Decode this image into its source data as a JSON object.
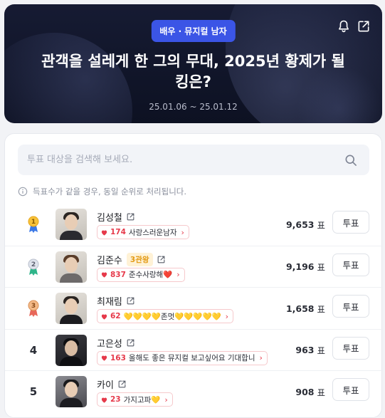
{
  "header": {
    "category": "배우 · 뮤지컬 남자",
    "title": "관객을 설레게 한 그의 무대, 2025년 황제가 될 킹은?",
    "dates": "25.01.06 ~ 25.01.12",
    "icons": [
      "bell-icon",
      "share-icon"
    ]
  },
  "search": {
    "placeholder": "투표 대상을 검색해 보세요."
  },
  "notice": "득표수가 같을 경우, 동일 순위로 처리됩니다.",
  "vote_unit": "표",
  "vote_label": "투표",
  "colors": {
    "accent": "#3b55e6",
    "cheer_red": "#e6394a",
    "gold": "#e39a14",
    "header_bg": "#161b33"
  },
  "ranking": [
    {
      "rank": "1",
      "medal": "gold",
      "name": "김성철",
      "winner_tag": "",
      "cheer_count": "174",
      "cheer_msg": "사랑스러운남자",
      "votes": "9,653"
    },
    {
      "rank": "2",
      "medal": "silver",
      "name": "김준수",
      "winner_tag": "3관왕",
      "cheer_count": "837",
      "cheer_msg": "준수사랑해❤️",
      "votes": "9,196"
    },
    {
      "rank": "3",
      "medal": "bronze",
      "name": "최재림",
      "winner_tag": "",
      "cheer_count": "62",
      "cheer_msg": "💛💛💛💛존멋💛💛💛💛💛",
      "votes": "1,658"
    },
    {
      "rank": "4",
      "medal": "",
      "name": "고은성",
      "winner_tag": "",
      "cheer_count": "163",
      "cheer_msg": "올해도 좋은 뮤지컬 보고싶어요 기대합니",
      "votes": "963"
    },
    {
      "rank": "5",
      "medal": "",
      "name": "카이",
      "winner_tag": "",
      "cheer_count": "23",
      "cheer_msg": "가지고파💛",
      "votes": "908"
    }
  ]
}
